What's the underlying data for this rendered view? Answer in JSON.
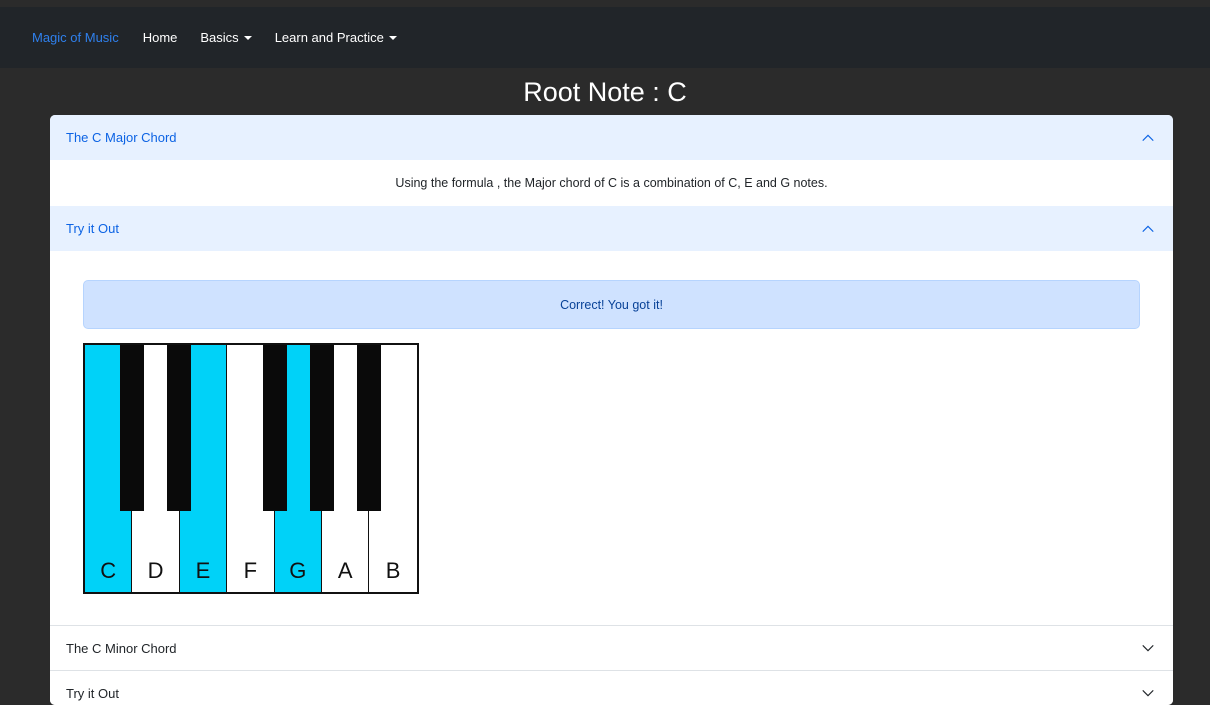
{
  "nav": {
    "brand": "Magic of Music",
    "links": [
      {
        "label": "Home"
      },
      {
        "label": "Basics"
      },
      {
        "label": "Learn and Practice"
      }
    ]
  },
  "page": {
    "title": "Root Note : C"
  },
  "accordion": [
    {
      "title": "The C Major Chord",
      "expanded": true,
      "body": "Using the formula , the Major chord of C is a combination of C, E and G notes."
    },
    {
      "title": "Try it Out",
      "expanded": true,
      "alert": "Correct! You got it!"
    },
    {
      "title": "The C Minor Chord",
      "expanded": false
    },
    {
      "title": "Try it Out",
      "expanded": false
    }
  ],
  "piano": {
    "white_keys": [
      "C",
      "D",
      "E",
      "F",
      "G",
      "A",
      "B"
    ],
    "highlighted": [
      "C",
      "E",
      "G"
    ],
    "highlight_color": "#00d2f8"
  }
}
